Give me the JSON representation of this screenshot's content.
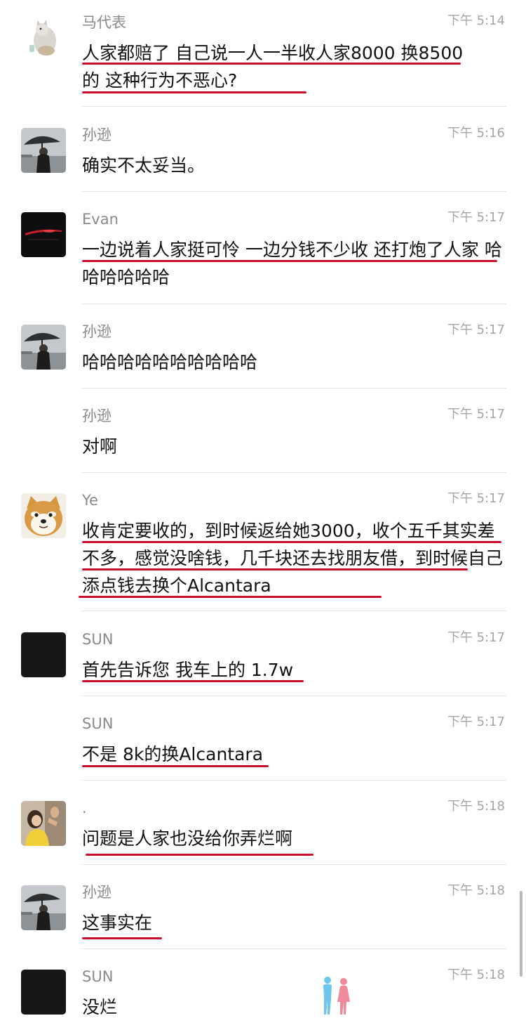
{
  "messages": [
    {
      "name": "马代表",
      "time": "下午 5:14",
      "text": "人家都赔了 自己说一人一半收人家8000 换8500的 这种行为不恶心?"
    },
    {
      "name": "孙逊",
      "time": "下午 5:16",
      "text": "确实不太妥当。"
    },
    {
      "name": "Evan",
      "time": "下午 5:17",
      "text": "一边说着人家挺可怜 一边分钱不少收 还打炮了人家 哈哈哈哈哈哈"
    },
    {
      "name": "孙逊",
      "time": "下午 5:17",
      "text": "哈哈哈哈哈哈哈哈哈哈"
    },
    {
      "name": "孙逊",
      "time": "下午 5:17",
      "text": "对啊"
    },
    {
      "name": "Ye",
      "time": "下午 5:17",
      "text": "收肯定要收的，到时候返给她3000，收个五千其实差不多，感觉没啥钱，几千块还去找朋友借，到时候自己添点钱去换个Alcantara"
    },
    {
      "name": "SUN",
      "time": "下午 5:17",
      "text": "首先告诉您 我车上的 1.7w"
    },
    {
      "name": "SUN",
      "time": "下午 5:17",
      "text": "不是 8k的换Alcantara"
    },
    {
      "name": ".",
      "time": "下午 5:18",
      "text": "问题是人家也没给你弄烂啊"
    },
    {
      "name": "孙逊",
      "time": "下午 5:18",
      "text": "这事实在"
    },
    {
      "name": "SUN",
      "time": "下午 5:18",
      "text": "没烂"
    }
  ],
  "colors": {
    "underline": "#c8102e",
    "name": "#8a8a8a",
    "time": "#a5a5a5",
    "text": "#111111",
    "divider": "#e3e3e3"
  },
  "avatars": {
    "ma": "cat-figurine-avatar",
    "sun_xun": "umbrella-person-avatar",
    "evan": "dark-car-taillight-avatar",
    "ye": "shiba-dog-avatar",
    "sun": "black-square-avatar",
    "dot": "woman-photo-avatar"
  },
  "watermark": "couple-silhouette-watermark"
}
